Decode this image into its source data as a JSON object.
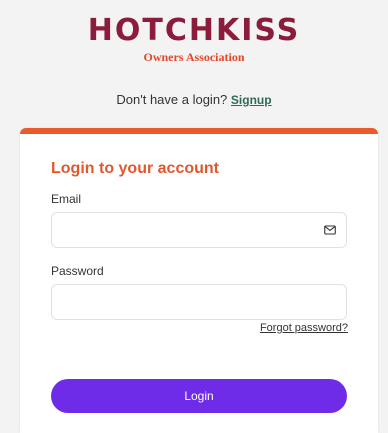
{
  "brand": {
    "name": "HOTCHKISS",
    "subtitle": "Owners Association"
  },
  "signup": {
    "prompt": "Don't have a login?",
    "link_label": "Signup"
  },
  "login_form": {
    "title": "Login to your account",
    "email_label": "Email",
    "email_value": "",
    "password_label": "Password",
    "password_value": "",
    "forgot_label": "Forgot password?",
    "submit_label": "Login"
  },
  "colors": {
    "brand": "#8b1c3b",
    "accent": "#ea5a2d",
    "button": "#6e2be8",
    "link": "#2e6b53"
  },
  "icons": {
    "email_field": "mail-icon"
  }
}
